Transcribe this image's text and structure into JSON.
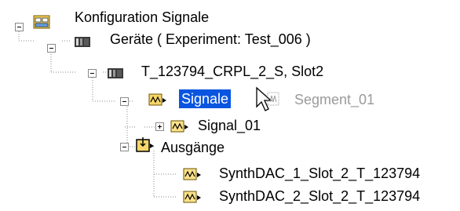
{
  "tree": {
    "root": {
      "label": "Konfiguration Signale",
      "icon": "config-panel-icon"
    },
    "devices": {
      "label": "Geräte ( Experiment: Test_006 )",
      "icon": "device-icon"
    },
    "device": {
      "label": "T_123794_CRPL_2_S, Slot2",
      "icon": "device-icon"
    },
    "signals": {
      "label": "Signale",
      "icon": "signal-folder-icon",
      "selected": true
    },
    "drag_ghost": {
      "label": "Segment_01",
      "icon": "segment-icon"
    },
    "signal_01": {
      "label": "Signal_01",
      "icon": "signal-icon"
    },
    "outputs": {
      "label": "Ausgänge",
      "icon": "outputs-folder-icon"
    },
    "out1": {
      "label": "SynthDAC_1_Slot_2_T_123794",
      "icon": "output-signal-icon"
    },
    "out2": {
      "label": "SynthDAC_2_Slot_2_T_123794",
      "icon": "output-signal-icon"
    }
  },
  "colors": {
    "selection": "#0a55e0",
    "tree_line": "#8a8a8a"
  }
}
